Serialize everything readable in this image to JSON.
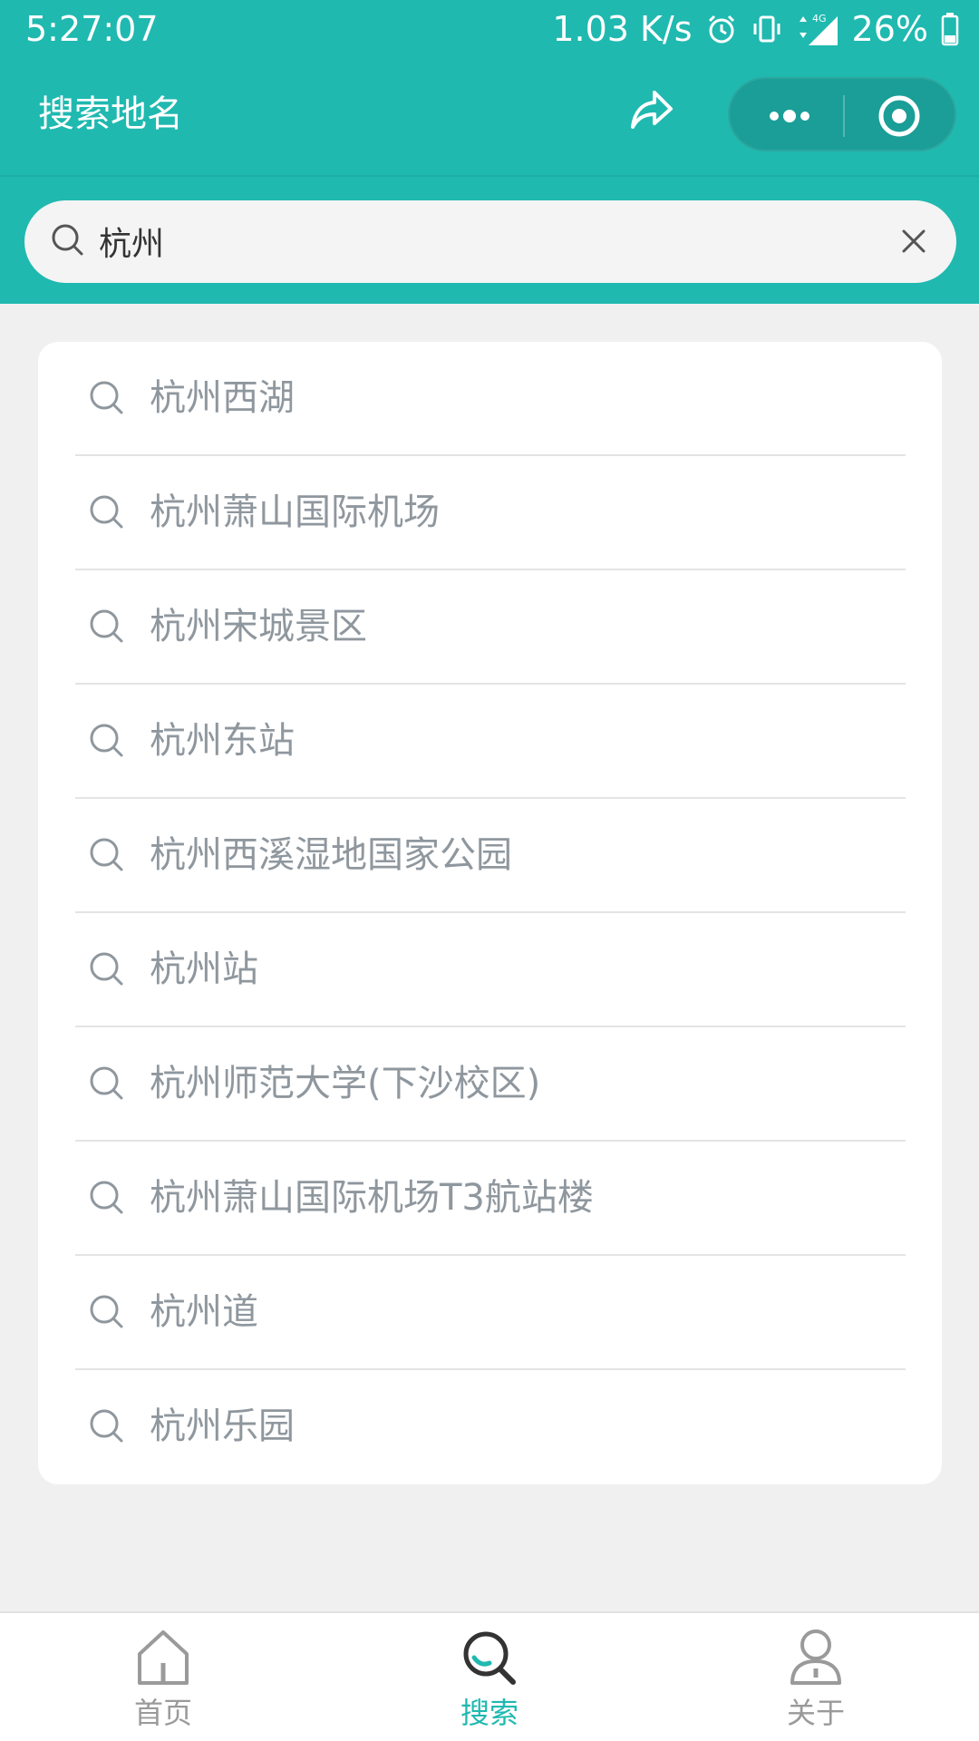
{
  "status_bar": {
    "time": "5:27:07",
    "net_speed": "1.03 K/s",
    "network": "4G",
    "battery": "26%"
  },
  "nav": {
    "title": "搜索地名"
  },
  "search": {
    "value": "杭州",
    "placeholder": ""
  },
  "results": [
    {
      "label": "杭州西湖"
    },
    {
      "label": "杭州萧山国际机场"
    },
    {
      "label": "杭州宋城景区"
    },
    {
      "label": "杭州东站"
    },
    {
      "label": "杭州西溪湿地国家公园"
    },
    {
      "label": "杭州站"
    },
    {
      "label": "杭州师范大学(下沙校区)"
    },
    {
      "label": "杭州萧山国际机场T3航站楼"
    },
    {
      "label": "杭州道"
    },
    {
      "label": "杭州乐园"
    }
  ],
  "tab_bar": {
    "tabs": [
      {
        "label": "首页",
        "icon": "home-icon",
        "active": false
      },
      {
        "label": "搜索",
        "icon": "search-icon",
        "active": true
      },
      {
        "label": "关于",
        "icon": "user-icon",
        "active": false
      }
    ],
    "active_color": "#1fb9b0",
    "inactive_color": "#9a9a9a"
  },
  "colors": {
    "accent": "#1fb9b0",
    "background": "#f0f0f0"
  }
}
